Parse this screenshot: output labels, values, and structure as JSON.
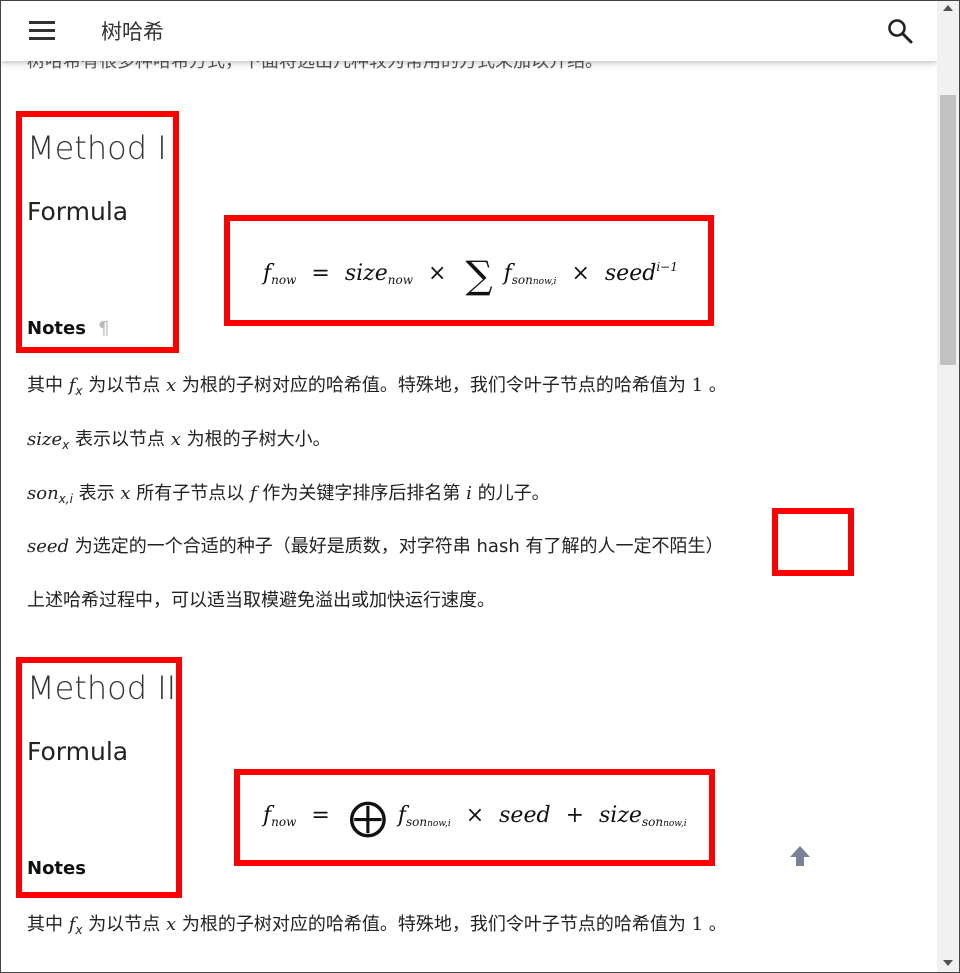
{
  "app": {
    "title": "树哈希",
    "menu_icon": "menu-icon",
    "search_icon": "search-icon"
  },
  "clipped_intro": "树哈希有很多种哈希方式，下面将选出几种较为常用的方式来加以介绍。",
  "method1": {
    "heading": "Method I",
    "formula_heading": "Formula",
    "notes_heading": "Notes",
    "pilcrow": "¶",
    "formula": {
      "lhs": "f",
      "lhs_sub": "now",
      "eq": "=",
      "size": "size",
      "size_sub": "now",
      "times": "×",
      "sum": "∑",
      "f": "f",
      "f_sub": "son",
      "f_subsub": "now,i",
      "times2": "×",
      "seed": "seed",
      "seed_sup": "i−1"
    },
    "notes": [
      {
        "pre": "其中 ",
        "m1": "f",
        "m1sub": "x",
        "mid": " 为以节点 ",
        "m2": "x",
        "post": " 为根的子树对应的哈希值。特殊地，我们令叶子节点的哈希值为 ",
        "m3": "1",
        "end": " 。"
      },
      {
        "m1": "size",
        "m1sub": "x",
        "mid": " 表示以节点 ",
        "m2": "x",
        "post": " 为根的子树大小。"
      },
      {
        "m1": "son",
        "m1sub": "x,i",
        "mid": " 表示 ",
        "m2": "x",
        "post": " 所有子节点以 ",
        "m3": "f",
        "post2": " 作为关键字排序后排名第 ",
        "m4": "i",
        "end": " 的儿子。"
      },
      {
        "m1": "seed",
        "post": " 为选定的一个合适的种子（最好是质数，对字符串 hash 有了解的人一定不陌生）"
      },
      {
        "post": "上述哈希过程中，可以适当取模避免溢出或加快运行速度。"
      }
    ]
  },
  "method2": {
    "heading": "Method II",
    "formula_heading": "Formula",
    "notes_heading": "Notes",
    "formula": {
      "lhs": "f",
      "lhs_sub": "now",
      "eq": "=",
      "xor": "⨁",
      "f": "f",
      "f_sub": "son",
      "f_subsub": "now,i",
      "times": "×",
      "seed": "seed",
      "plus": "+",
      "size": "size",
      "size_sub": "son",
      "size_subsub": "now,i"
    },
    "notes": [
      {
        "pre": "其中 ",
        "m1": "f",
        "m1sub": "x",
        "mid": " 为以节点 ",
        "m2": "x",
        "post": " 为根的子树对应的哈希值。特殊地，我们令叶子节点的哈希值为 ",
        "m3": "1",
        "end": " 。"
      }
    ]
  },
  "back_to_top_icon": "arrow-up-icon",
  "colors": {
    "highlight_box": "#ff0000",
    "text": "#222222",
    "scroll_thumb": "#c1c1c1"
  }
}
